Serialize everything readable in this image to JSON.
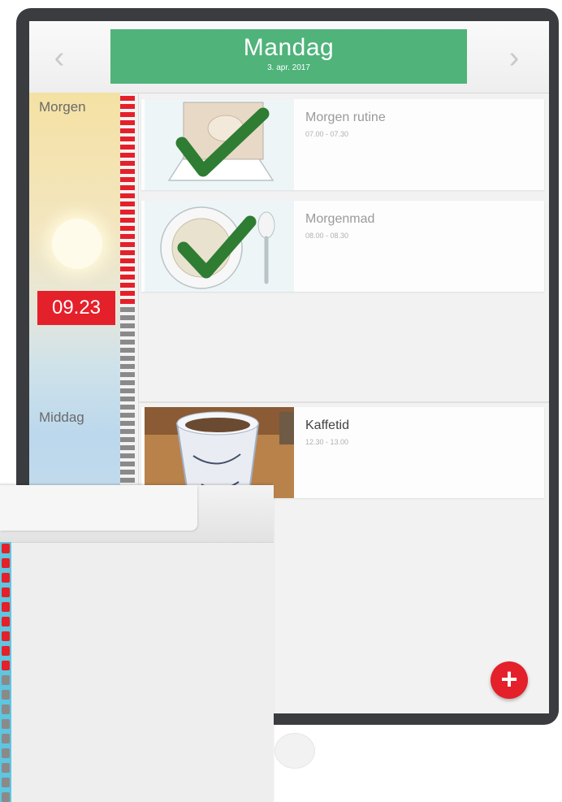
{
  "header": {
    "day": "Mandag",
    "date": "3. apr. 2017",
    "prev_icon": "‹",
    "next_icon": "›"
  },
  "timeline": {
    "current_time": "09.23",
    "periods": [
      {
        "label": "Morgen"
      },
      {
        "label": "Middag"
      }
    ]
  },
  "activities": [
    {
      "title": "Morgen rutine",
      "time": "07.00 - 07.30",
      "status": "done",
      "icon": "bed-check-icon"
    },
    {
      "title": "Morgenmad",
      "time": "08.00 - 08.30",
      "status": "done",
      "icon": "porridge-check-icon"
    },
    {
      "title": "Kaffetid",
      "time": "12.30 - 13.00",
      "status": "upcoming",
      "icon": "coffee-cup-image"
    }
  ],
  "add_button": {
    "label": "+"
  },
  "colors": {
    "accent_green": "#4fb37a",
    "alert_red": "#e4202a",
    "tick_red": "#e4202a",
    "tick_gray": "#8a8a8a",
    "check_green": "#2e7d32"
  }
}
